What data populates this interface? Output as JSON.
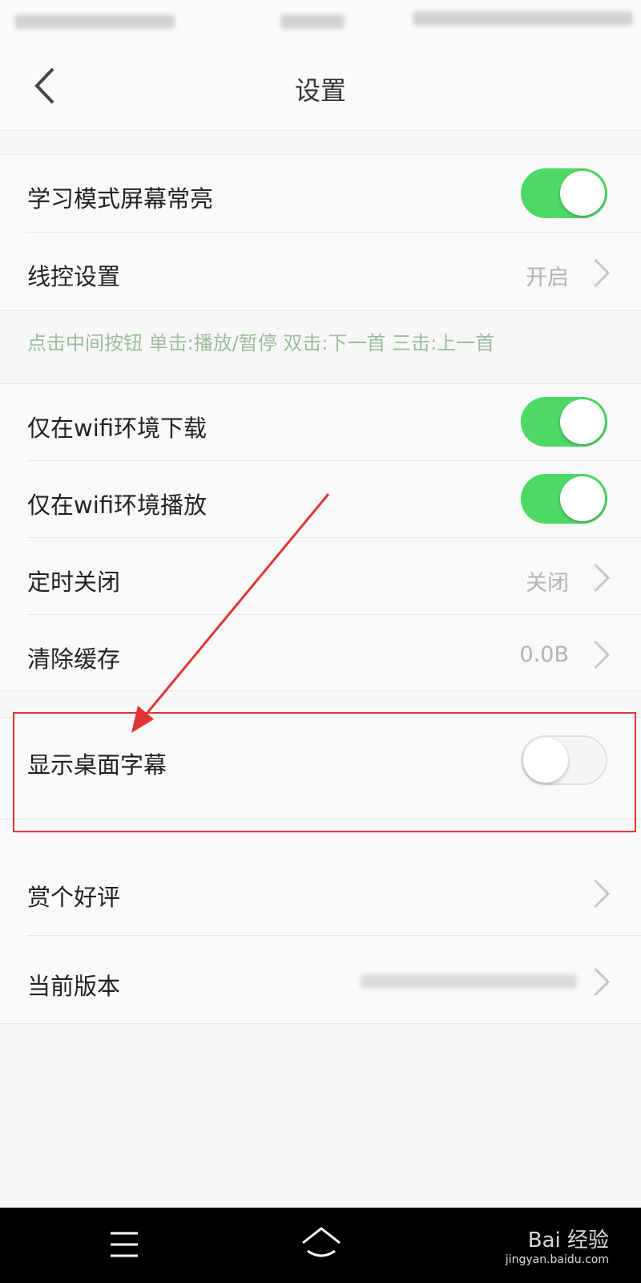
{
  "header": {
    "title": "设置"
  },
  "section1": {
    "screen_on": {
      "label": "学习模式屏幕常亮",
      "toggle": "on"
    },
    "wire_control": {
      "label": "线控设置",
      "value": "开启"
    },
    "hint": "点击中间按钮 单击:播放/暂停 双击:下一首 三击:上一首"
  },
  "section2": {
    "wifi_download": {
      "label": "仅在wifi环境下载",
      "toggle": "on"
    },
    "wifi_play": {
      "label": "仅在wifi环境播放",
      "toggle": "on"
    },
    "timer_close": {
      "label": "定时关闭",
      "value": "关闭"
    },
    "clear_cache": {
      "label": "清除缓存",
      "value": "0.0B"
    }
  },
  "section3": {
    "desktop_lyrics": {
      "label": "显示桌面字幕",
      "toggle": "off"
    }
  },
  "section4": {
    "rate": {
      "label": "赏个好评"
    },
    "version": {
      "label": "当前版本"
    }
  },
  "colors": {
    "toggle_on": "#4cd964",
    "highlight": "#e03434"
  },
  "watermark": {
    "brand": "Bai 经验",
    "url": "jingyan.baidu.com"
  }
}
